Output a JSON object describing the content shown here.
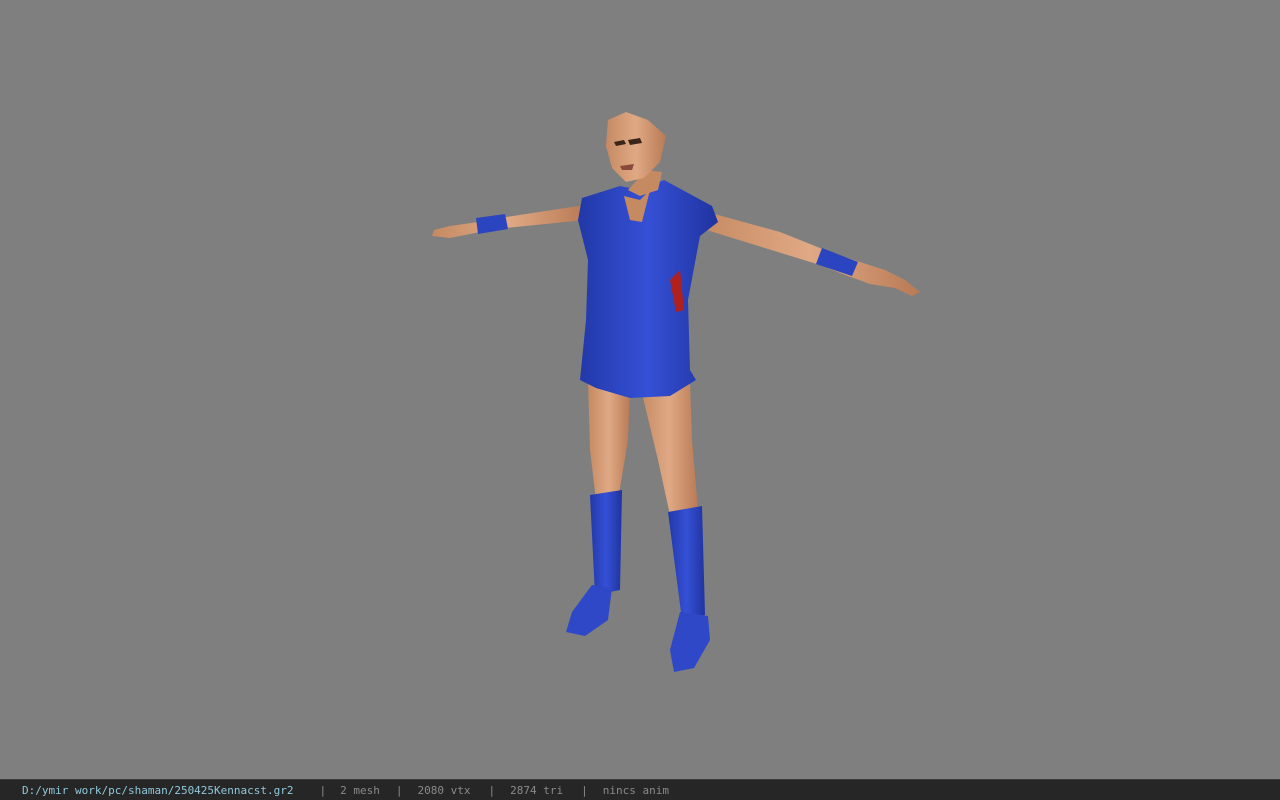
{
  "viewport": {
    "background": "#7f7f7f",
    "model_name": "3d-character-model"
  },
  "statusbar": {
    "file_path": "D:/ymir work/pc/shaman/250425Kennacst.gr2",
    "separator": "|",
    "mesh_count": "2 mesh",
    "vertex_count": "2080 vtx",
    "triangle_count": "2874 tri",
    "anim_status": "nincs anim"
  },
  "colors": {
    "skin": "#d9a07a",
    "outfit": "#2f47c4",
    "statusbar_bg": "#262626",
    "path_text": "#8fc8dc"
  }
}
